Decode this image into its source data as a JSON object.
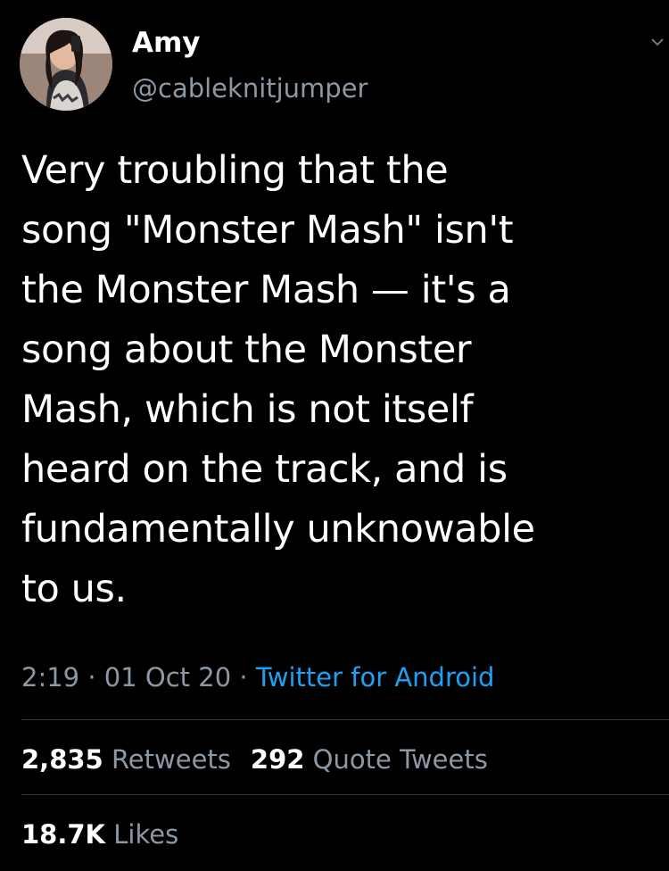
{
  "author": {
    "display_name": "Amy",
    "handle": "@cableknitjumper",
    "avatar_icon": "profile-photo"
  },
  "tweet": {
    "lines": [
      "Very troubling that the",
      "song \"Monster Mash\" isn't",
      "the Monster Mash — it's a",
      "song about the Monster",
      "Mash, which is not itself",
      "heard on the track, and is",
      "fundamentally unknowable",
      "to us."
    ]
  },
  "meta": {
    "time": "2:19",
    "separator": " · ",
    "date": "01 Oct 20",
    "source": "Twitter for Android"
  },
  "stats": {
    "retweets_count": "2,835",
    "retweets_label": "Retweets",
    "quotes_count": "292",
    "quotes_label": "Quote Tweets",
    "likes_count": "18.7K",
    "likes_label": "Likes"
  },
  "colors": {
    "background": "#000000",
    "text": "#ffffff",
    "secondary": "#8b98a5",
    "link": "#1da1f2",
    "divider": "#2f3336"
  }
}
